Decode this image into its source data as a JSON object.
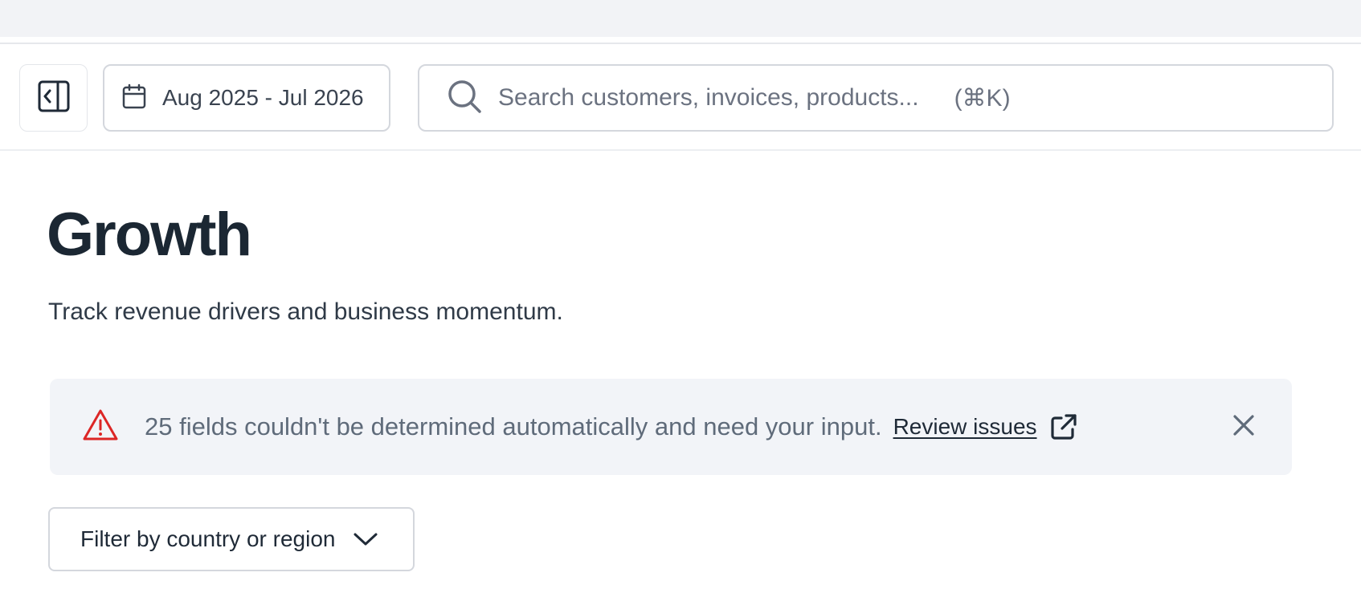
{
  "toolbar": {
    "sidebar_toggle_icon": "panel-left-collapse-icon",
    "date_range": {
      "icon": "calendar-icon",
      "label": "Aug 2025 - Jul 2026"
    },
    "search": {
      "icon": "search-icon",
      "placeholder": "Search customers, invoices, products...",
      "shortcut": "(⌘K)"
    }
  },
  "page": {
    "title": "Growth",
    "subtitle": "Track revenue drivers and business momentum."
  },
  "alert": {
    "icon": "warning-triangle-icon",
    "message": "25 fields couldn't be determined automatically and need your input.",
    "link_label": "Review issues",
    "link_icon": "external-link-icon",
    "close_icon": "close-icon",
    "icon_color": "#dc2626"
  },
  "filter": {
    "label": "Filter by country or region",
    "icon": "chevron-down-icon"
  }
}
